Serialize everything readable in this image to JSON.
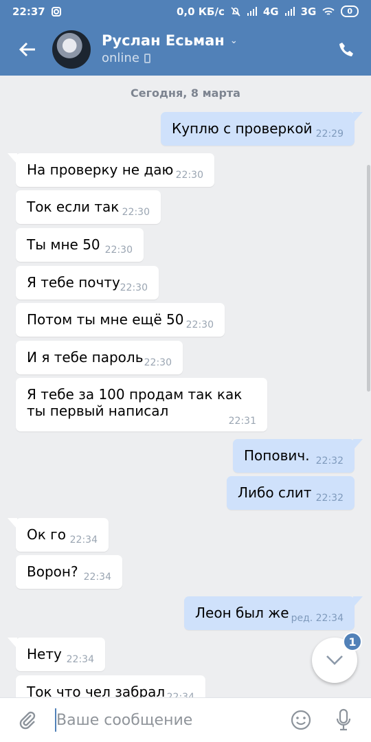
{
  "status_bar": {
    "time": "22:37",
    "speed": "0,0 КБ/с",
    "network_1": "4G",
    "network_2": "3G",
    "battery": "0"
  },
  "header": {
    "name": "Руслан Есьман",
    "status": "online"
  },
  "chat": {
    "date": "Сегодня, 8 марта",
    "messages": [
      {
        "text": "Куплю с проверкой",
        "time": "22:29",
        "direction": "out"
      },
      {
        "text": "На проверку не даю",
        "time": "22:30",
        "direction": "in"
      },
      {
        "text": "Ток если так",
        "time": "22:30",
        "direction": "in"
      },
      {
        "text": "Ты мне 50",
        "time": "22:30",
        "direction": "in"
      },
      {
        "text": "Я тебе почту",
        "time": "22:30",
        "direction": "in"
      },
      {
        "text": "Потом ты мне ещё 50",
        "time": "22:30",
        "direction": "in"
      },
      {
        "text": "И я тебе пароль",
        "time": "22:30",
        "direction": "in"
      },
      {
        "text": "Я тебе за 100 продам так как ты первый написал",
        "time": "22:31",
        "direction": "in"
      },
      {
        "text": "Попович.",
        "time": "22:32",
        "direction": "out"
      },
      {
        "text": "Либо слит",
        "time": "22:32",
        "direction": "out"
      },
      {
        "text": "Ок го",
        "time": "22:34",
        "direction": "in"
      },
      {
        "text": "Ворон?",
        "time": "22:34",
        "direction": "in"
      },
      {
        "text": "Леон был же",
        "time": "ред. 22:34",
        "direction": "out"
      },
      {
        "text": "Нету",
        "time": "22:34",
        "direction": "in"
      },
      {
        "text": "Ток что чел забрал",
        "time": "22:34",
        "direction": "in"
      }
    ]
  },
  "scroll_badge": "1",
  "composer": {
    "placeholder": "Ваше сообщение"
  },
  "icons": {
    "back": "back-arrow-icon",
    "call": "phone-icon",
    "attach": "paperclip-icon",
    "emoji": "smile-icon",
    "mic": "microphone-icon",
    "scroll": "chevron-down-icon"
  },
  "colors": {
    "header": "#5181b8",
    "background": "#edeef0",
    "incoming_bubble": "#ffffff",
    "outgoing_bubble": "#cfe1fb",
    "accent": "#5181b8"
  }
}
